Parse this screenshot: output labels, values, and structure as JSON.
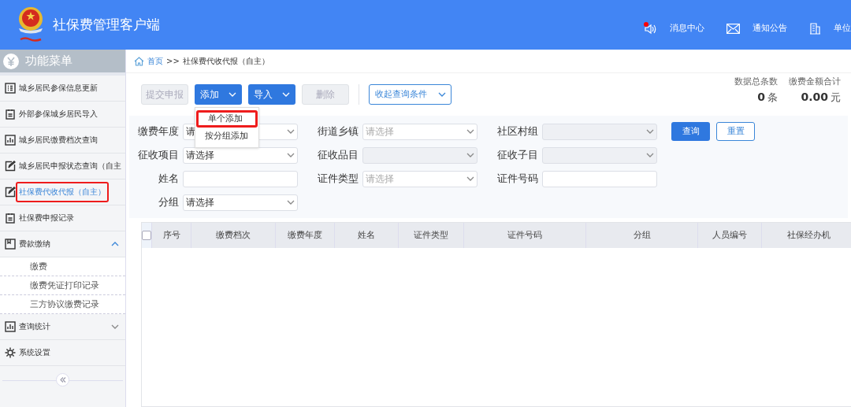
{
  "header": {
    "title": "社保费管理客户端",
    "links": [
      {
        "label": "消息中心",
        "kind": "speaker",
        "badge": true
      },
      {
        "label": "通知公告",
        "kind": "mail",
        "badge": false
      },
      {
        "label": "单位",
        "kind": "building",
        "badge": false
      }
    ]
  },
  "sidebar": {
    "title": "功能菜单",
    "items": [
      {
        "label": "城乡居民参保信息更新",
        "kind": "grid",
        "selected": false,
        "highlighted": false
      },
      {
        "label": "外部参保城乡居民导入",
        "kind": "clipboard",
        "selected": false,
        "highlighted": false
      },
      {
        "label": "城乡居民缴费档次查询",
        "kind": "chart",
        "selected": false,
        "highlighted": false
      },
      {
        "label": "城乡居民申报状态查询（自主",
        "kind": "edit",
        "selected": false,
        "highlighted": false
      },
      {
        "label": "社保费代收代报（自主）",
        "kind": "edit",
        "selected": true,
        "highlighted": true
      },
      {
        "label": "社保费申报记录",
        "kind": "clipboard",
        "selected": false,
        "highlighted": false
      },
      {
        "label": "费款缴纳",
        "kind": "book",
        "selected": false,
        "highlighted": false,
        "expanded": true,
        "children": [
          {
            "label": "缴费"
          },
          {
            "label": "缴费凭证打印记录"
          },
          {
            "label": "三方协议缴费记录"
          }
        ]
      },
      {
        "label": "查询统计",
        "kind": "chart",
        "selected": false,
        "highlighted": false,
        "expanded": false
      },
      {
        "label": "系统设置",
        "kind": "gear",
        "selected": false,
        "highlighted": false
      }
    ]
  },
  "breadcrumb": {
    "home": "首页",
    "separator": ">>",
    "current": "社保费代收代报（自主）"
  },
  "toolbar": [
    {
      "label": "提交申报",
      "disabled": true,
      "dropdown": false
    },
    {
      "label": "添加",
      "disabled": false,
      "dropdown": true
    },
    {
      "label": "导入",
      "disabled": false,
      "dropdown": true
    },
    {
      "label": "删除",
      "disabled": true,
      "dropdown": false
    }
  ],
  "collapse_button": "收起查询条件",
  "add_menu": [
    {
      "label": "单个添加",
      "highlighted": true
    },
    {
      "label": "按分组添加",
      "highlighted": false
    }
  ],
  "stats": [
    {
      "label": "数据总条数",
      "value": "0",
      "unit": "条"
    },
    {
      "label": "缴费金额合计",
      "value": "0.00",
      "unit": "元"
    }
  ],
  "filters": [
    [
      {
        "label": "缴费年度",
        "kind": "select",
        "value": "请",
        "disabled": false
      },
      {
        "label": "街道乡镇",
        "kind": "select",
        "placeholder": "请选择",
        "disabled": false
      },
      {
        "label": "社区村组",
        "kind": "select",
        "disabled": true
      }
    ],
    [
      {
        "label": "征收项目",
        "kind": "select",
        "value": "请选择",
        "disabled": false
      },
      {
        "label": "征收品目",
        "kind": "select",
        "disabled": true
      },
      {
        "label": "征收子目",
        "kind": "select",
        "disabled": true
      }
    ],
    [
      {
        "label": "姓名",
        "kind": "text",
        "disabled": false
      },
      {
        "label": "证件类型",
        "kind": "select",
        "placeholder": "请选择",
        "disabled": false
      },
      {
        "label": "证件号码",
        "kind": "text",
        "disabled": false
      }
    ],
    [
      {
        "label": "分组",
        "kind": "select",
        "value": "请选择",
        "disabled": false
      }
    ]
  ],
  "search_buttons": [
    "查询",
    "重置"
  ],
  "table": {
    "select_all_checked": false,
    "columns": [
      "序号",
      "缴费档次",
      "缴费年度",
      "姓名",
      "证件类型",
      "证件号码",
      "分组",
      "人员编号",
      "社保经办机"
    ]
  }
}
